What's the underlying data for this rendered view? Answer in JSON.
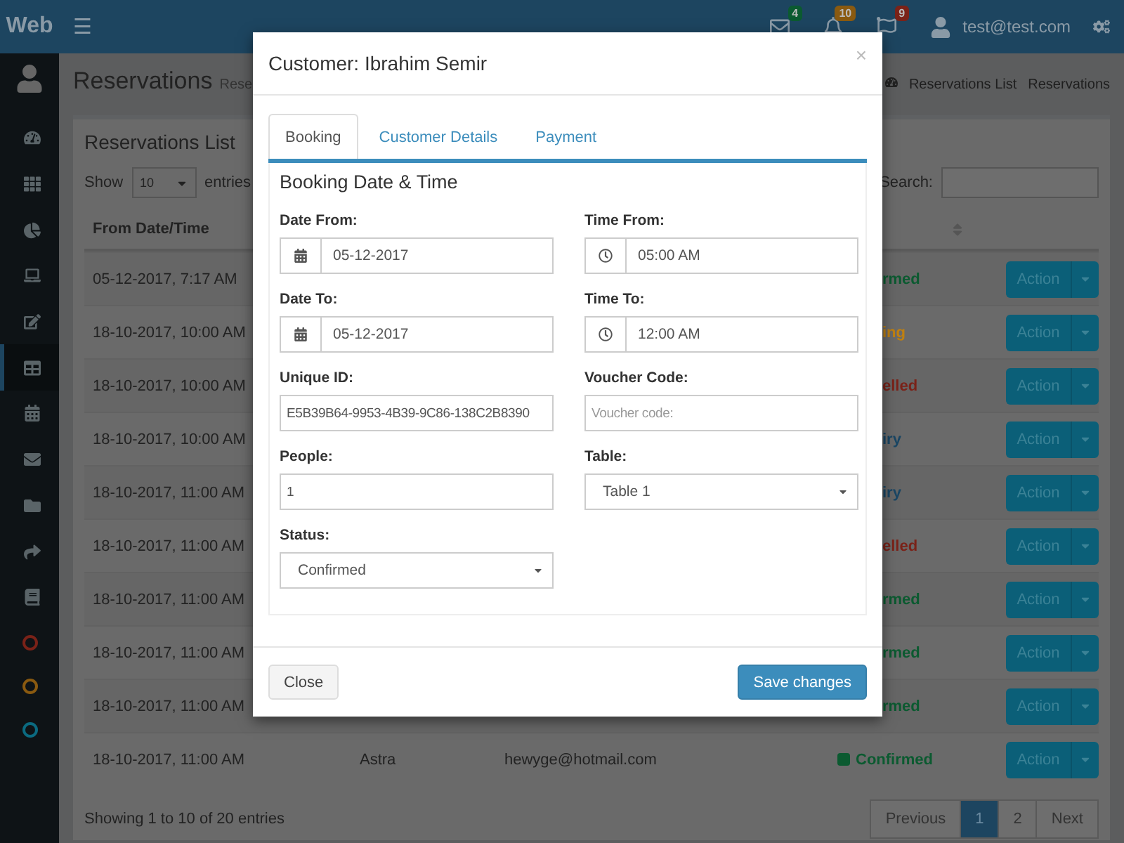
{
  "header": {
    "logo": "Web",
    "menu_glyph": "☰",
    "notifications": [
      {
        "kind": "mail",
        "count": "4",
        "color": "#0b5a30"
      },
      {
        "kind": "bell",
        "count": "10",
        "color": "#8a5a10"
      },
      {
        "kind": "flag",
        "count": "9",
        "color": "#7a2218"
      }
    ],
    "user": "test@test.com"
  },
  "sidebar": {
    "items": [
      {
        "kind": "dashboard",
        "selected": false
      },
      {
        "kind": "grid",
        "selected": false
      },
      {
        "kind": "pie",
        "selected": false
      },
      {
        "kind": "laptop",
        "selected": false
      },
      {
        "kind": "edit",
        "selected": false
      },
      {
        "kind": "table",
        "selected": true
      },
      {
        "kind": "calendar",
        "selected": false
      },
      {
        "kind": "mail",
        "selected": false
      },
      {
        "kind": "folder",
        "selected": false
      },
      {
        "kind": "share",
        "selected": false
      },
      {
        "kind": "book",
        "selected": false
      }
    ],
    "labels": [
      {
        "color": "#7a2218"
      },
      {
        "color": "#8a5a10"
      },
      {
        "color": "#0b6a80"
      }
    ]
  },
  "page": {
    "title": "Reservations",
    "subtitle": "Rese",
    "breadcrumbs": [
      "Reservations List",
      "Reservations"
    ]
  },
  "box": {
    "title": "Reservations List",
    "show_label": "Show",
    "page_size": "10",
    "entries_label": "entries",
    "search_label": "Search:",
    "columns": [
      "From Date/Time"
    ],
    "rows": [
      {
        "kind": "covered",
        "date": "05-12-2017, 7:17 AM",
        "status": "rmed",
        "color": "#0b5a30",
        "action": "Action"
      },
      {
        "kind": "covered",
        "date": "18-10-2017, 10:00 AM",
        "status": "ing",
        "color": "#c08010",
        "action": "Action"
      },
      {
        "kind": "covered",
        "date": "18-10-2017, 10:00 AM",
        "status": "elled",
        "color": "#7a2218",
        "action": "Action"
      },
      {
        "kind": "covered",
        "date": "18-10-2017, 10:00 AM",
        "status": "iry",
        "color": "#1a4664",
        "action": "Action"
      },
      {
        "kind": "covered",
        "date": "18-10-2017, 11:00 AM",
        "status": "iry",
        "color": "#1a4664",
        "action": "Action"
      },
      {
        "kind": "covered",
        "date": "18-10-2017, 11:00 AM",
        "status": "elled",
        "color": "#7a2218",
        "action": "Action"
      },
      {
        "kind": "covered",
        "date": "18-10-2017, 11:00 AM",
        "status": "rmed",
        "color": "#0b5a30",
        "action": "Action"
      },
      {
        "kind": "covered",
        "date": "18-10-2017, 11:00 AM",
        "status": "rmed",
        "color": "#0b5a30",
        "action": "Action"
      },
      {
        "kind": "covered",
        "date": "18-10-2017, 11:00 AM",
        "status": "rmed",
        "color": "#0b5a30",
        "action": "Action"
      },
      {
        "kind": "full",
        "date": "18-10-2017, 11:00 AM",
        "name": "Astra",
        "email": "hewyge@hotmail.com",
        "status": "Confirmed",
        "color": "#0b5a30",
        "action": "Action"
      }
    ],
    "info": "Showing 1 to 10 of 20 entries",
    "pagination": [
      {
        "label": "Previous",
        "selected": false
      },
      {
        "label": "1",
        "selected": true
      },
      {
        "label": "2",
        "selected": false
      },
      {
        "label": "Next",
        "selected": false
      }
    ]
  },
  "modal": {
    "title": "Customer: Ibrahim Semir",
    "close_glyph": "×",
    "tabs": [
      {
        "label": "Booking",
        "selected": true
      },
      {
        "label": "Customer Details",
        "selected": false
      },
      {
        "label": "Payment",
        "selected": false
      }
    ],
    "section_title": "Booking Date & Time",
    "fields": [
      {
        "kind": "date",
        "label": "Date From:",
        "value": "05-12-2017"
      },
      {
        "kind": "time",
        "label": "Time From:",
        "value": "05:00 AM"
      },
      {
        "kind": "date",
        "label": "Date To:",
        "value": "05-12-2017"
      },
      {
        "kind": "time",
        "label": "Time To:",
        "value": "12:00 AM"
      },
      {
        "kind": "text",
        "label": "Unique ID:",
        "value": "E5B39B64-9953-4B39-9C86-138C2B8390"
      },
      {
        "kind": "text",
        "label": "Voucher Code:",
        "placeholder": "Voucher code:"
      },
      {
        "kind": "text",
        "label": "People:",
        "value": "1"
      },
      {
        "kind": "select",
        "label": "Table:",
        "value": "Table 1"
      },
      {
        "kind": "select",
        "label": "Status:",
        "value": "Confirmed"
      }
    ],
    "buttons": [
      {
        "kind": "default",
        "label": "Close"
      },
      {
        "kind": "primary",
        "label": "Save changes"
      }
    ]
  }
}
